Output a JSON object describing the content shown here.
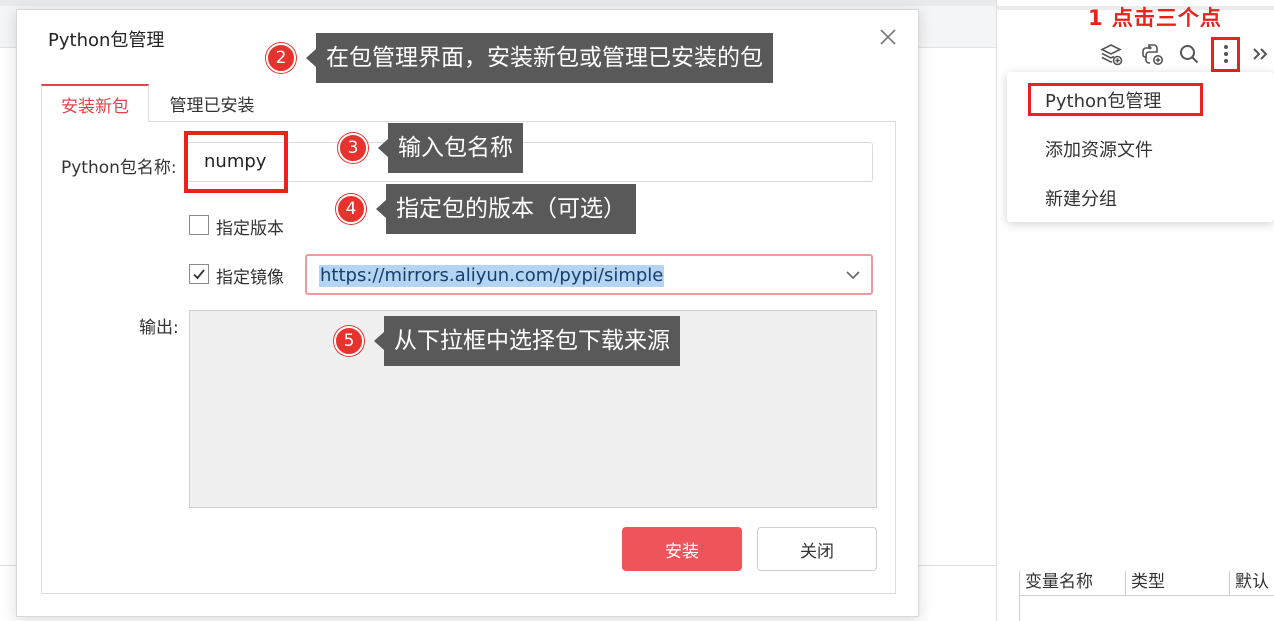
{
  "background": {
    "right_toolbar": {
      "icons": [
        "layers-add-icon",
        "python-add-icon",
        "search-icon",
        "more-vertical-icon",
        "double-chevron-right-icon"
      ]
    },
    "dropdown_menu": {
      "items": [
        "Python包管理",
        "添加资源文件",
        "新建分组"
      ]
    },
    "variables_table": {
      "columns": [
        "变量名称",
        "类型",
        "默认"
      ]
    }
  },
  "dialog": {
    "title": "Python包管理",
    "tabs": [
      {
        "label": "安装新包",
        "active": true
      },
      {
        "label": "管理已安装",
        "active": false
      }
    ],
    "package_name": {
      "label": "Python包名称:",
      "value": "numpy"
    },
    "specify_version": {
      "label": "指定版本",
      "checked": false
    },
    "specify_mirror": {
      "label": "指定镜像",
      "checked": true,
      "selected": "https://mirrors.aliyun.com/pypi/simple"
    },
    "output": {
      "label": "输出:",
      "value": ""
    },
    "buttons": {
      "install": "安装",
      "close": "关闭"
    }
  },
  "annotations": {
    "step1": "1 点击三个点",
    "step2": {
      "num": "2",
      "text": "在包管理界面，安装新包或管理已安装的包"
    },
    "step3": {
      "num": "3",
      "text": "输入包名称"
    },
    "step4": {
      "num": "4",
      "text": "指定包的版本（可选）"
    },
    "step5": {
      "num": "5",
      "text": "从下拉框中选择包下载来源"
    }
  },
  "colors": {
    "accent": "#e8404a",
    "annotation_red": "#e8231b",
    "callout_bg": "#595959",
    "selection": "#b4d4f3"
  }
}
